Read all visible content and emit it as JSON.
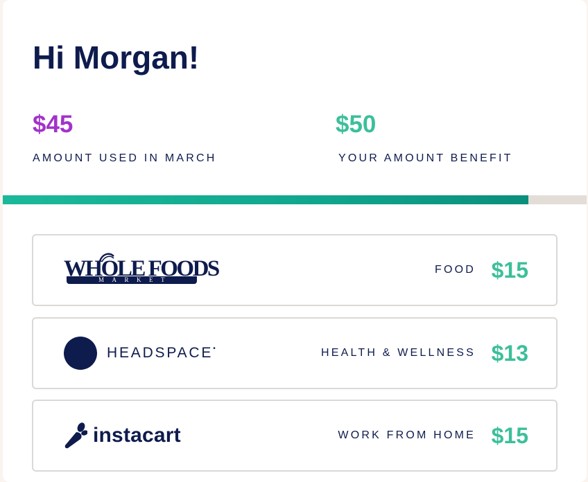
{
  "greeting": "Hi Morgan!",
  "summary": {
    "used_amount": "$45",
    "used_label": "AMOUNT USED IN MARCH",
    "benefit_amount": "$50",
    "benefit_label": "YOUR AMOUNT BENEFIT",
    "progress_fraction": 0.9
  },
  "colors": {
    "used": "#a233c9",
    "benefit": "#3cbf9a",
    "text": "#0e1b4d",
    "progress_fill": "#10a68e",
    "progress_track": "#e3ddd8"
  },
  "merchants": [
    {
      "name": "WHOLE FOODS",
      "subname": "MARKET",
      "logo_icon": "whole-foods-logo",
      "category": "FOOD",
      "amount": "$15"
    },
    {
      "name": "HEADSPACE",
      "mark": "•",
      "logo_icon": "headspace-dot-icon",
      "category": "HEALTH & WELLNESS",
      "amount": "$13"
    },
    {
      "name": "instacart",
      "logo_icon": "carrot-icon",
      "category": "WORK FROM HOME",
      "amount": "$15"
    }
  ]
}
